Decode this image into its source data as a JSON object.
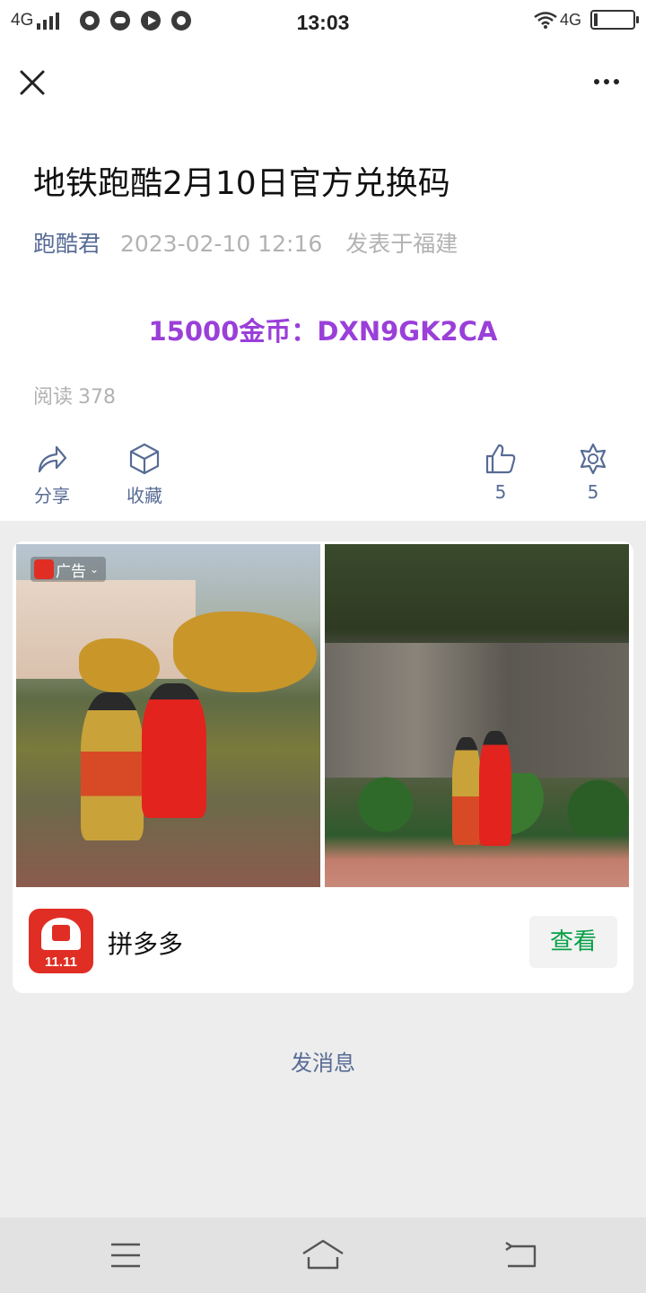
{
  "status_bar": {
    "network_left": "4G",
    "time": "13:03",
    "network_right": "4G"
  },
  "header": {
    "close_icon": "close-icon",
    "more_icon": "more-dots-icon"
  },
  "article": {
    "title": "地铁跑酷2月10日官方兑换码",
    "author": "跑酷君",
    "date": "2023-02-10 12:16",
    "location": "发表于福建",
    "code_text": "15000金币：DXN9GK2CA",
    "code_color": "#9a3fd9",
    "reads_label": "阅读",
    "reads_count": "378"
  },
  "actions": {
    "share_label": "分享",
    "favorite_label": "收藏",
    "like_count": "5",
    "wow_count": "5"
  },
  "ad": {
    "tag": "广告",
    "app_name": "拼多多",
    "app_icon_text": "11.11",
    "view_button": "查看",
    "button_color": "#07a047"
  },
  "footer": {
    "send_message": "发消息"
  },
  "colors": {
    "link": "#576b95",
    "muted": "#b2b2b2",
    "background": "#ededed",
    "brand_red": "#e02e24"
  }
}
